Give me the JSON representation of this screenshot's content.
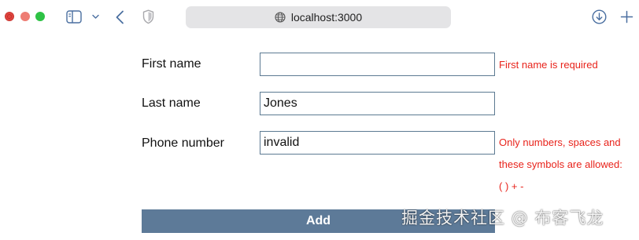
{
  "browser": {
    "url": "localhost:3000",
    "icons": {
      "sidebar": "sidebar-toggle-icon",
      "dropdown": "chevron-down-icon",
      "back": "chevron-left-icon",
      "shield": "shield-icon",
      "site": "globe-icon",
      "downloads": "download-icon",
      "new_tab": "plus-icon"
    }
  },
  "form": {
    "first_name": {
      "label": "First name",
      "value": "",
      "error": "First name is required"
    },
    "last_name": {
      "label": "Last name",
      "value": "Jones"
    },
    "phone": {
      "label": "Phone number",
      "value": "invalid",
      "error": "Only numbers, spaces and these symbols are allowed: ( ) + -"
    },
    "submit_label": "Add"
  },
  "watermark": "掘金技术社区 @ 布客飞龙",
  "colors": {
    "error": "#e8231b",
    "button": "#5d7a98",
    "input_border": "#5c7a92"
  }
}
